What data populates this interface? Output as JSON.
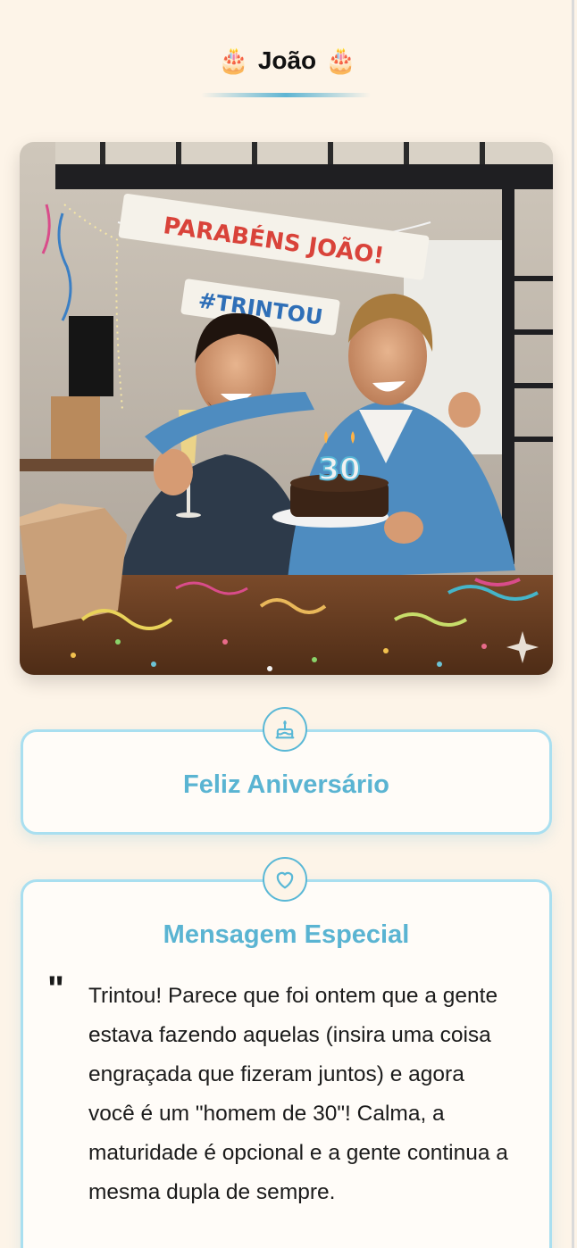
{
  "header": {
    "left_emoji": "🎂",
    "name": "João",
    "right_emoji": "🎂"
  },
  "photo": {
    "banner_line1": "PARABÉNS JOÃO!",
    "banner_line2": "#TRINTOU",
    "candle_number": "30"
  },
  "cards": {
    "greeting": {
      "icon": "cake-icon",
      "title": "Feliz Aniversário"
    },
    "message": {
      "icon": "heart-icon",
      "title": "Mensagem Especial",
      "quote_mark": "\"",
      "text": "Trintou! Parece que foi ontem que a gente estava fazendo aquelas (insira uma coisa engraçada que fizeram juntos) e agora você é um \"homem de 30\"! Calma, a maturidade é opcional e a gente continua a mesma dupla de sempre."
    }
  },
  "colors": {
    "background": "#fdf4e8",
    "accent": "#5ab4d2",
    "card_border": "#a9dff0"
  }
}
